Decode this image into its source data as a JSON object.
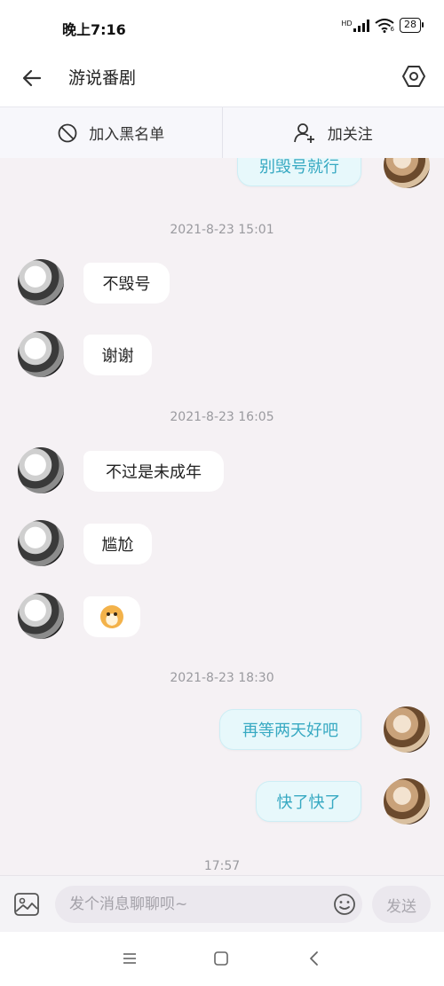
{
  "status_bar": {
    "time": "晚上7:16",
    "network_badge": "HD",
    "wifi_badge": "6",
    "battery": "28",
    "icons": [
      "signal-icon",
      "wifi-icon",
      "battery-icon"
    ]
  },
  "header": {
    "title": "游说番剧",
    "icons": [
      "back-arrow-icon",
      "settings-hexagon-icon"
    ]
  },
  "actions": {
    "block": {
      "label": "加入黑名单",
      "icon": "block-icon"
    },
    "follow": {
      "label": "加关注",
      "icon": "add-user-icon"
    }
  },
  "chat": {
    "timestamps": [
      "2021-8-23 15:01",
      "2021-8-23 16:05",
      "2021-8-23 18:30",
      "17:57"
    ],
    "messages": [
      {
        "side": "right",
        "text": "别毁号就行"
      },
      {
        "side": "left",
        "text": "不毁号"
      },
      {
        "side": "left",
        "text": "谢谢"
      },
      {
        "side": "left",
        "text": "不过是未成年"
      },
      {
        "side": "left",
        "text": "尴尬"
      },
      {
        "side": "left",
        "text": "",
        "emoji": "doge-emoji"
      },
      {
        "side": "right",
        "text": "再等两天好吧"
      },
      {
        "side": "right",
        "text": "快了快了"
      }
    ]
  },
  "input_bar": {
    "placeholder": "发个消息聊聊呗~",
    "value": "",
    "send_label": "发送",
    "icons": [
      "image-icon",
      "emoji-icon"
    ]
  },
  "nav_bar": {
    "icons": [
      "menu-icon",
      "home-square-icon",
      "back-chevron-icon"
    ]
  },
  "colors": {
    "chat_background": "#f5f1f4",
    "sent_bubble_bg": "#e7f8fb",
    "sent_bubble_text": "#37a9c2",
    "received_bubble_bg": "#ffffff",
    "timestamp_text": "#9a9a9f"
  }
}
